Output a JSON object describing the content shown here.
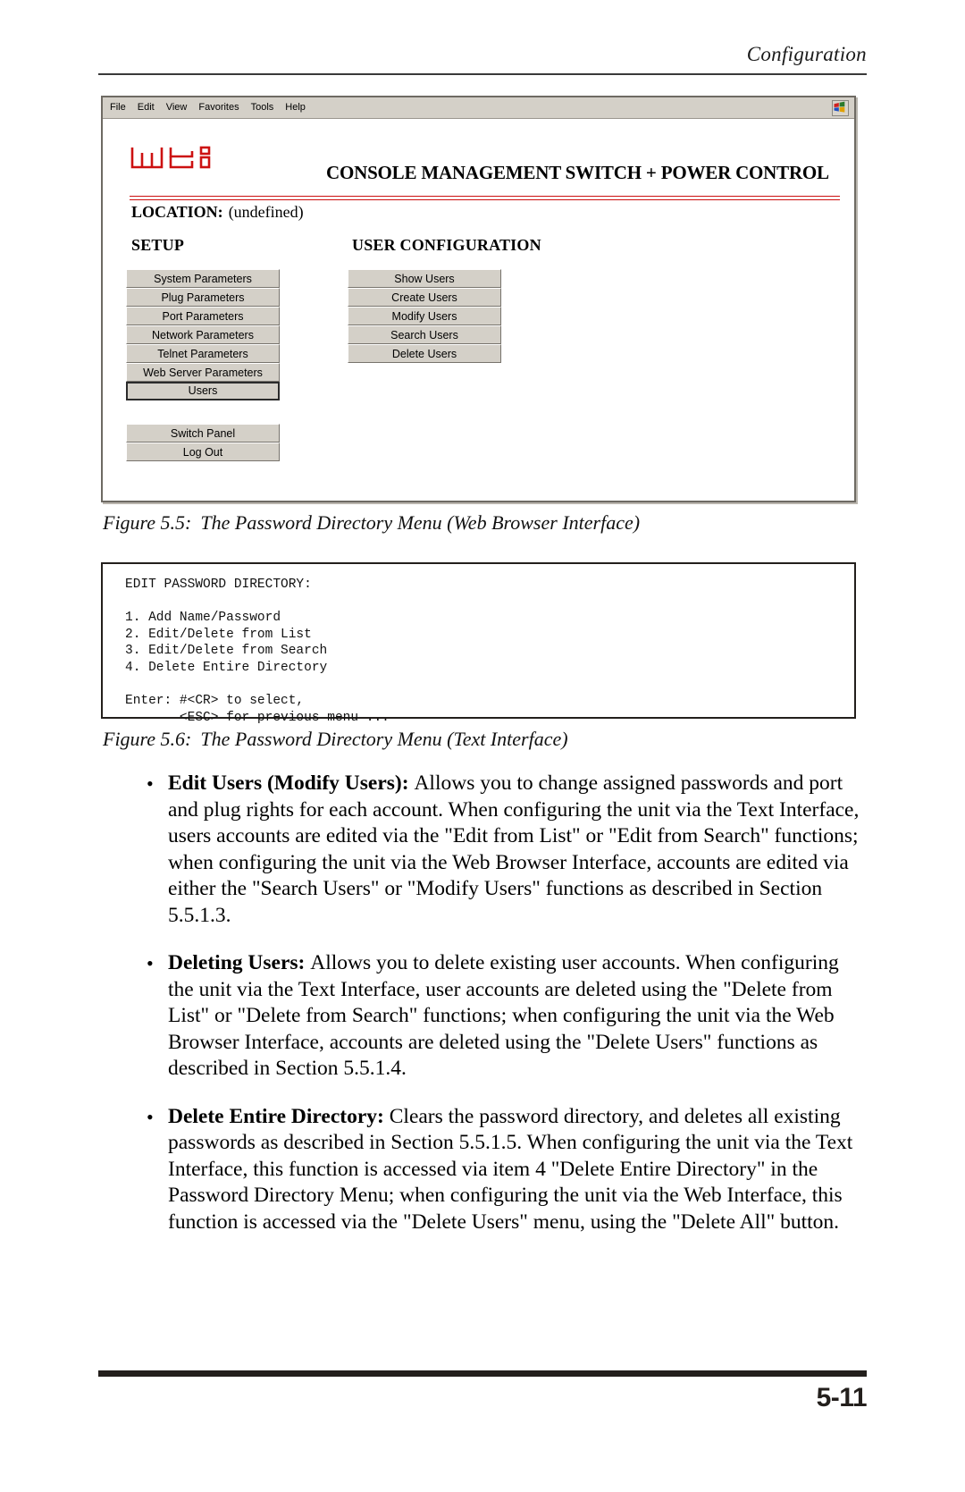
{
  "page": {
    "header_title": "Configuration",
    "page_number": "5-11"
  },
  "browser": {
    "menubar": [
      {
        "label": "File"
      },
      {
        "label": "Edit"
      },
      {
        "label": "View"
      },
      {
        "label": "Favorites"
      },
      {
        "label": "Tools"
      },
      {
        "label": "Help"
      }
    ],
    "brand_icon": "windows-flag-icon",
    "logo_text": "wti",
    "product_title": "CONSOLE MANAGEMENT SWITCH + POWER CONTROL",
    "location_label": "LOCATION:",
    "location_value": "(undefined)",
    "setup": {
      "heading": "SETUP",
      "buttons": [
        {
          "label": "System Parameters",
          "selected": false
        },
        {
          "label": "Plug Parameters",
          "selected": false
        },
        {
          "label": "Port Parameters",
          "selected": false
        },
        {
          "label": "Network Parameters",
          "selected": false
        },
        {
          "label": "Telnet Parameters",
          "selected": false
        },
        {
          "label": "Web Server Parameters",
          "selected": false
        },
        {
          "label": "Users",
          "selected": true
        }
      ],
      "extra_buttons": [
        {
          "label": "Switch Panel",
          "selected": false
        },
        {
          "label": "Log Out",
          "selected": false
        }
      ]
    },
    "user_configuration": {
      "heading": "USER CONFIGURATION",
      "buttons": [
        {
          "label": "Show Users",
          "selected": false
        },
        {
          "label": "Create Users",
          "selected": false
        },
        {
          "label": "Modify Users",
          "selected": false
        },
        {
          "label": "Search Users",
          "selected": false
        },
        {
          "label": "Delete Users",
          "selected": false
        }
      ]
    }
  },
  "figure_55": {
    "number": "Figure 5.5:",
    "title": "The Password Directory Menu (Web Browser Interface)"
  },
  "figure_56": {
    "number": "Figure 5.6:",
    "title": "The Password Directory Menu (Text Interface)"
  },
  "text_interface": {
    "content": "EDIT PASSWORD DIRECTORY:\n\n1. Add Name/Password\n2. Edit/Delete from List\n3. Edit/Delete from Search\n4. Delete Entire Directory\n\nEnter: #<CR> to select,\n       <ESC> for previous menu ..."
  },
  "bullets": [
    {
      "marker": "•",
      "lead": "Edit Users (Modify Users):",
      "body": "Allows you to change assigned passwords and port and plug rights for each account.  When configuring the unit via the Text Interface, users accounts are edited via the \"Edit from List\" or \"Edit from Search\" functions; when configuring the unit via the Web Browser Interface, accounts are edited via either the \"Search Users\" or \"Modify Users\" functions as described in Section 5.5.1.3."
    },
    {
      "marker": "•",
      "lead": "Deleting Users:",
      "body": "Allows you to delete existing user accounts.  When configuring the unit via the Text Interface, user accounts are deleted using the \"Delete from List\" or \"Delete from Search\" functions; when configuring the unit via the Web Browser Interface, accounts are deleted using the \"Delete Users\" functions as described in Section 5.5.1.4."
    },
    {
      "marker": "•",
      "lead": "Delete Entire Directory:",
      "body": "Clears the password directory, and deletes all existing passwords as described in Section 5.5.1.5.  When configuring the unit via the Text Interface, this function is accessed via item 4 \"Delete Entire Directory\" in the Password Directory Menu; when configuring the unit via the Web Interface, this function is accessed via the \"Delete Users\" menu, using the \"Delete All\" button."
    }
  ],
  "colors": {
    "accent_red": "#cc1111",
    "chrome_gray": "#d4d0c8",
    "rule_dark": "#231f1c"
  }
}
